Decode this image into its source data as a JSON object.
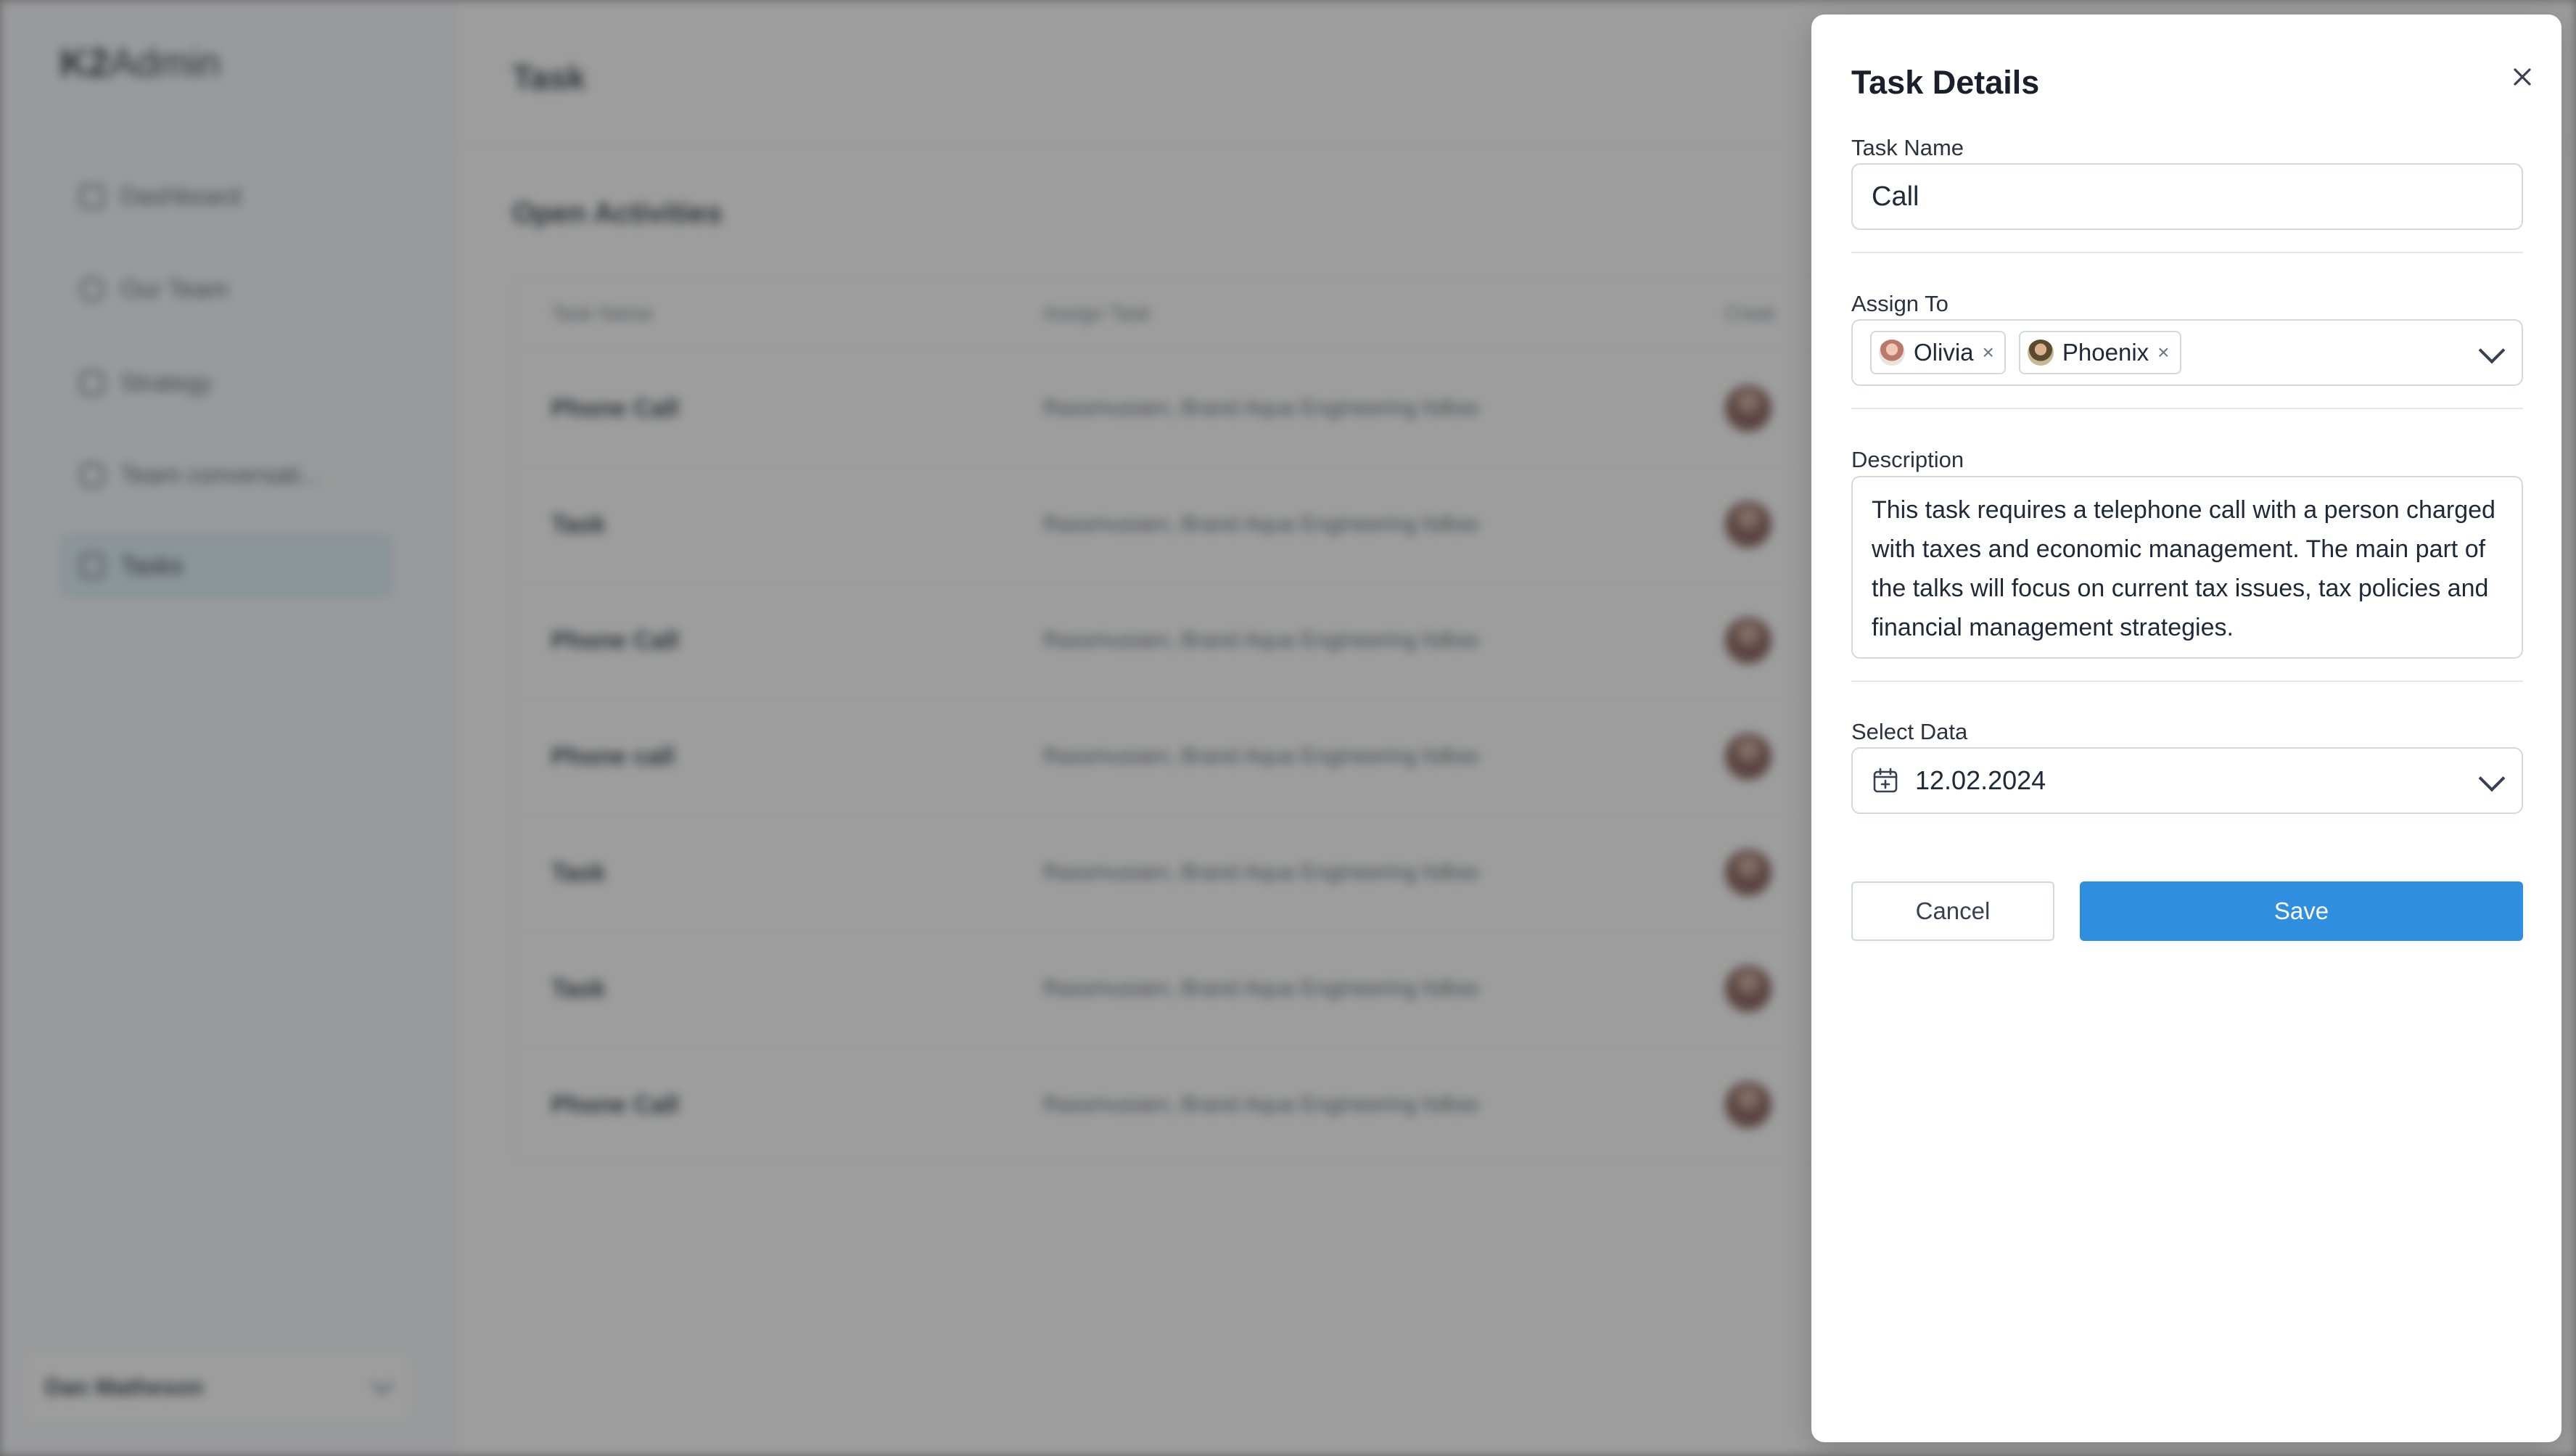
{
  "app": {
    "logo_bold": "K2",
    "logo_rest": "Admin",
    "page_title": "Task",
    "section_title": "Open Activities",
    "nav": [
      {
        "label": "Dashboard",
        "icon": "grid-icon"
      },
      {
        "label": "Our Team",
        "icon": "user-icon"
      },
      {
        "label": "Strategy",
        "icon": "chart-icon"
      },
      {
        "label": "Team conversati...",
        "icon": "chat-icon"
      },
      {
        "label": "Tasks",
        "icon": "tasks-icon",
        "active": true
      }
    ],
    "user_name": "Dan Matheson",
    "table": {
      "headers": [
        "Task Name",
        "Assign Task",
        "Creat"
      ],
      "rows": [
        {
          "name": "Phone Call",
          "assign": "Rassmussen, Brand Aqua Engineering follow"
        },
        {
          "name": "Task",
          "assign": "Rassmussen, Brand Aqua Engineering follow"
        },
        {
          "name": "Phone Call",
          "assign": "Rassmussen, Brand Aqua Engineering follow"
        },
        {
          "name": "Phone call",
          "assign": "Rassmussen, Brand Aqua Engineering follow"
        },
        {
          "name": "Task",
          "assign": "Rassmussen, Brand Aqua Engineering follow"
        },
        {
          "name": "Task",
          "assign": "Rassmussen, Brand Aqua Engineering follow"
        },
        {
          "name": "Phone Call",
          "assign": "Rassmussen, Brand Aqua Engineering follow"
        }
      ]
    }
  },
  "dialog": {
    "title": "Task Details",
    "task_name": {
      "label": "Task Name",
      "value": "Call"
    },
    "assign_to": {
      "label": "Assign To",
      "assignees": [
        {
          "name": "Olivia",
          "remove": "×"
        },
        {
          "name": "Phoenix",
          "remove": "×"
        }
      ]
    },
    "description": {
      "label": "Description",
      "value": "This task requires a telephone call with a person charged with taxes and economic management. The main part of the talks will focus on current tax issues, tax policies and financial management strategies."
    },
    "select_date": {
      "label": "Select Data",
      "value": "12.02.2024"
    },
    "cancel_label": "Cancel",
    "save_label": "Save"
  },
  "colors": {
    "primary": "#2f8ee0",
    "active_nav": "#dbeef9",
    "overlay": "#6b6b6b"
  }
}
